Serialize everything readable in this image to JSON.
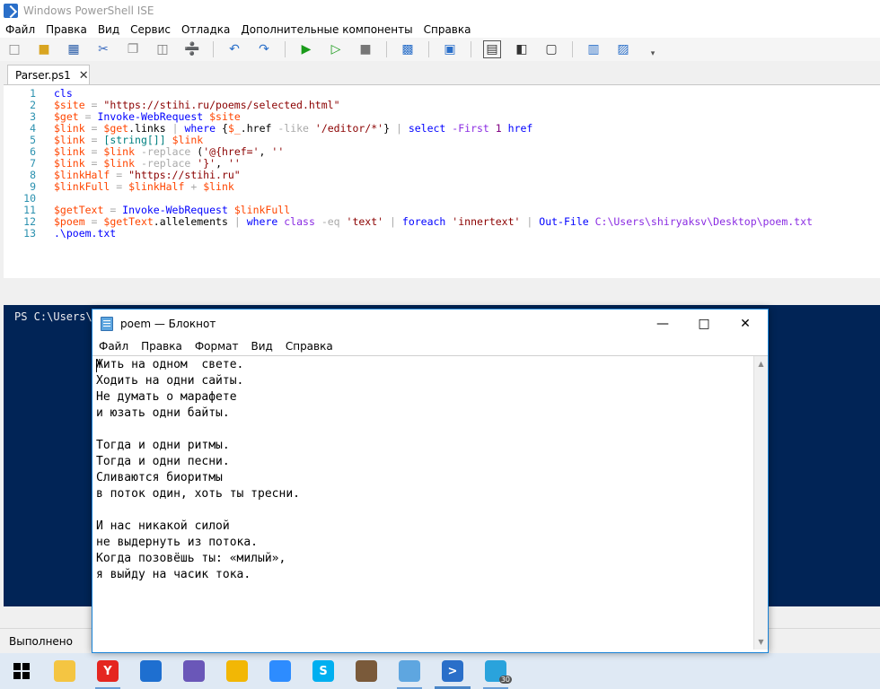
{
  "window": {
    "title": "Windows PowerShell ISE"
  },
  "menu": [
    "Файл",
    "Правка",
    "Вид",
    "Сервис",
    "Отладка",
    "Дополнительные компоненты",
    "Справка"
  ],
  "toolbar": {
    "buttons": [
      "new-icon",
      "open-icon",
      "save-icon",
      "cut-icon",
      "copy-icon",
      "paste-icon",
      "clear-icon",
      "undo-icon",
      "redo-icon",
      "run-icon",
      "run-selection-icon",
      "stop-icon",
      "remote-icon",
      "console-icon",
      "layout-top-icon",
      "layout-right-icon",
      "layout-max-icon",
      "commands-icon",
      "addon-icon"
    ]
  },
  "tab": {
    "label": "Parser.ps1"
  },
  "editor": {
    "lines": [
      {
        "n": "1",
        "tokens": [
          [
            "cmd",
            "cls"
          ]
        ]
      },
      {
        "n": "2",
        "tokens": [
          [
            "var",
            "$site"
          ],
          [
            "op",
            " = "
          ],
          [
            "str",
            "\"https://stihi.ru/poems/selected.html\""
          ]
        ]
      },
      {
        "n": "3",
        "tokens": [
          [
            "var",
            "$get"
          ],
          [
            "op",
            " = "
          ],
          [
            "cmd",
            "Invoke-WebRequest"
          ],
          [
            "plain",
            " "
          ],
          [
            "var",
            "$site"
          ]
        ]
      },
      {
        "n": "4",
        "tokens": [
          [
            "var",
            "$link"
          ],
          [
            "op",
            " = "
          ],
          [
            "var",
            "$get"
          ],
          [
            "plain",
            ".links "
          ],
          [
            "op",
            "|"
          ],
          [
            "plain",
            " "
          ],
          [
            "cmd",
            "where"
          ],
          [
            "plain",
            " {"
          ],
          [
            "var",
            "$_"
          ],
          [
            "plain",
            ".href "
          ],
          [
            "op",
            "-like"
          ],
          [
            "plain",
            " "
          ],
          [
            "str",
            "'/editor/*'"
          ],
          [
            "plain",
            "} "
          ],
          [
            "op",
            "|"
          ],
          [
            "plain",
            " "
          ],
          [
            "cmd",
            "select"
          ],
          [
            "plain",
            " "
          ],
          [
            "par",
            "-First"
          ],
          [
            "plain",
            " "
          ],
          [
            "num",
            "1"
          ],
          [
            "plain",
            " "
          ],
          [
            "cmd",
            "href"
          ]
        ]
      },
      {
        "n": "5",
        "tokens": [
          [
            "var",
            "$link"
          ],
          [
            "op",
            " = "
          ],
          [
            "type",
            "[string[]]"
          ],
          [
            "plain",
            " "
          ],
          [
            "var",
            "$link"
          ]
        ]
      },
      {
        "n": "6",
        "tokens": [
          [
            "var",
            "$link"
          ],
          [
            "op",
            " = "
          ],
          [
            "var",
            "$link"
          ],
          [
            "plain",
            " "
          ],
          [
            "op",
            "-replace"
          ],
          [
            "plain",
            " ("
          ],
          [
            "str",
            "'@{href='"
          ],
          [
            "plain",
            ", "
          ],
          [
            "str",
            "''"
          ]
        ]
      },
      {
        "n": "7",
        "tokens": [
          [
            "var",
            "$link"
          ],
          [
            "op",
            " = "
          ],
          [
            "var",
            "$link"
          ],
          [
            "plain",
            " "
          ],
          [
            "op",
            "-replace"
          ],
          [
            "plain",
            " "
          ],
          [
            "str",
            "'}'"
          ],
          [
            "plain",
            ", "
          ],
          [
            "str",
            "''"
          ]
        ]
      },
      {
        "n": "8",
        "tokens": [
          [
            "var",
            "$linkHalf"
          ],
          [
            "op",
            " = "
          ],
          [
            "str",
            "\"https://stihi.ru\""
          ]
        ]
      },
      {
        "n": "9",
        "tokens": [
          [
            "var",
            "$linkFull"
          ],
          [
            "op",
            " = "
          ],
          [
            "var",
            "$linkHalf"
          ],
          [
            "op",
            " + "
          ],
          [
            "var",
            "$link"
          ]
        ]
      },
      {
        "n": "10",
        "tokens": []
      },
      {
        "n": "11",
        "tokens": [
          [
            "var",
            "$getText"
          ],
          [
            "op",
            " = "
          ],
          [
            "cmd",
            "Invoke-WebRequest"
          ],
          [
            "plain",
            " "
          ],
          [
            "var",
            "$linkFull"
          ]
        ]
      },
      {
        "n": "12",
        "tokens": [
          [
            "var",
            "$poem"
          ],
          [
            "op",
            " = "
          ],
          [
            "var",
            "$getText"
          ],
          [
            "plain",
            ".allelements "
          ],
          [
            "op",
            "|"
          ],
          [
            "plain",
            " "
          ],
          [
            "cmd",
            "where"
          ],
          [
            "plain",
            " "
          ],
          [
            "par",
            "class"
          ],
          [
            "plain",
            " "
          ],
          [
            "op",
            "-eq"
          ],
          [
            "plain",
            " "
          ],
          [
            "str",
            "'text'"
          ],
          [
            "plain",
            " "
          ],
          [
            "op",
            "|"
          ],
          [
            "plain",
            " "
          ],
          [
            "cmd",
            "foreach"
          ],
          [
            "plain",
            " "
          ],
          [
            "str",
            "'innertext'"
          ],
          [
            "plain",
            " "
          ],
          [
            "op",
            "|"
          ],
          [
            "plain",
            " "
          ],
          [
            "cmd",
            "Out-File"
          ],
          [
            "plain",
            " "
          ],
          [
            "par",
            "C:\\Users\\shiryaksv\\Desktop\\poem.txt"
          ]
        ]
      },
      {
        "n": "13",
        "tokens": [
          [
            "cmd",
            ".\\poem.txt"
          ]
        ]
      }
    ]
  },
  "console": {
    "prompt": "PS C:\\Users\\"
  },
  "status": {
    "text": "Выполнено"
  },
  "notepad": {
    "title": "poem — Блокнот",
    "menu": [
      "Файл",
      "Правка",
      "Формат",
      "Вид",
      "Справка"
    ],
    "lines": [
      "Жить на одном  свете.",
      "Ходить на одни сайты.",
      "Не думать о марафете",
      "и юзать одни байты.",
      "",
      "Тогда и одни ритмы.",
      "Тогда и одни песни.",
      "Сливаются биоритмы",
      "в поток один, хоть ты тресни.",
      "",
      "И нас никакой силой",
      "не выдернуть из потока.",
      "Когда позовёшь ты: «милый»,",
      "я выйду на часик тока."
    ]
  },
  "taskbar": {
    "items": [
      {
        "name": "start-icon",
        "color": "#000000",
        "glyph": ""
      },
      {
        "name": "explorer-icon",
        "color": "#f4c542",
        "glyph": ""
      },
      {
        "name": "yandex-browser-icon",
        "color": "#e52620",
        "glyph": "Y"
      },
      {
        "name": "edge-legacy-icon",
        "color": "#1e6fd0",
        "glyph": ""
      },
      {
        "name": "snipping-icon",
        "color": "#6a57b8",
        "glyph": ""
      },
      {
        "name": "sticky-notes-icon",
        "color": "#f2b705",
        "glyph": ""
      },
      {
        "name": "zoom-icon",
        "color": "#2d8cff",
        "glyph": ""
      },
      {
        "name": "skype-icon",
        "color": "#00aff0",
        "glyph": "S"
      },
      {
        "name": "archive-icon",
        "color": "#7a5a3a",
        "glyph": ""
      },
      {
        "name": "notepad-icon",
        "color": "#5ea6e0",
        "glyph": ""
      },
      {
        "name": "powershell-icon",
        "color": "#2a6fc9",
        "glyph": ">"
      },
      {
        "name": "telegram-icon",
        "color": "#2aa3dc",
        "glyph": ""
      }
    ],
    "badge": "30"
  }
}
